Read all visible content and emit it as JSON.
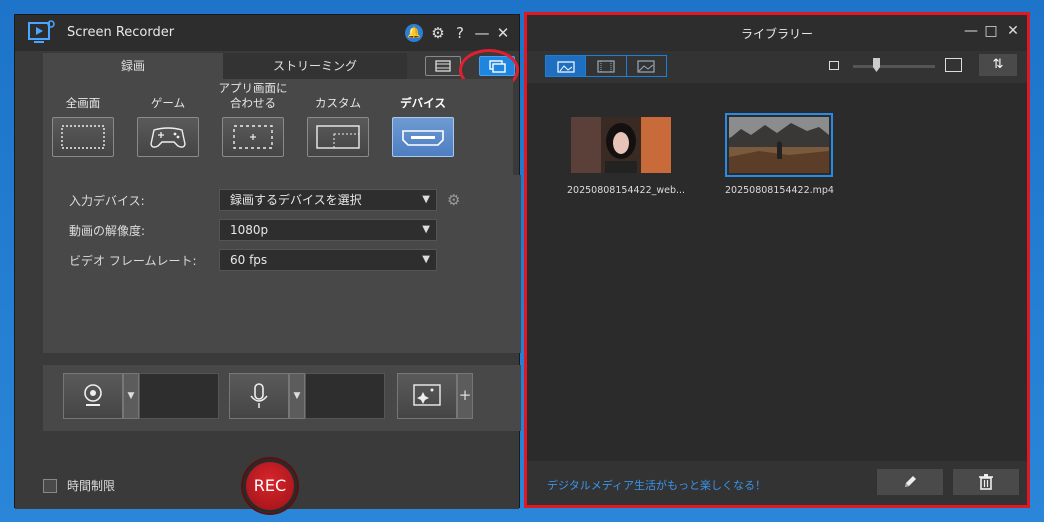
{
  "recorder": {
    "title": "Screen Recorder",
    "tabs": {
      "record": "録画",
      "streaming": "ストリーミング"
    },
    "capture_modes": [
      {
        "label": "全画面",
        "selected": false
      },
      {
        "label": "ゲーム",
        "selected": false
      },
      {
        "label": "アプリ画面に合わせる",
        "selected": false
      },
      {
        "label": "カスタム",
        "selected": false
      },
      {
        "label": "デバイス",
        "selected": true
      }
    ],
    "settings": {
      "input_device_label": "入力デバイス:",
      "input_device_value": "録画するデバイスを選択",
      "resolution_label": "動画の解像度:",
      "resolution_value": "1080p",
      "framerate_label": "ビデオ フレームレート:",
      "framerate_value": "60 fps"
    },
    "time_limit_label": "時間制限",
    "rec_label": "REC",
    "plus": "+",
    "help_glyph": "?"
  },
  "library": {
    "title": "ライブラリー",
    "items": [
      {
        "name": "20250808154422_web...",
        "selected": false
      },
      {
        "name": "20250808154422.mp4",
        "selected": true
      }
    ],
    "slogan": "デジタルメディア生活がもっと楽しくなる！"
  },
  "colors": {
    "accent": "#1e86e0",
    "highlight": "#e01826",
    "rec": "#c21a20"
  }
}
